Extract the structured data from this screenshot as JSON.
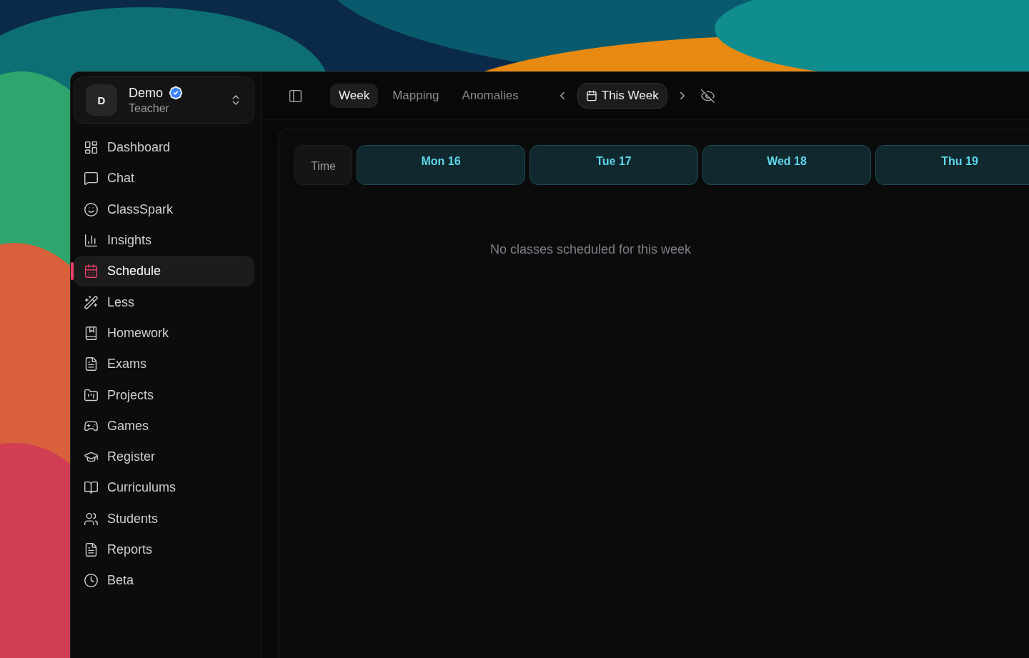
{
  "account": {
    "initial": "D",
    "name": "Demo",
    "verified": true,
    "role": "Teacher"
  },
  "sidebar": {
    "items": [
      {
        "label": "Dashboard",
        "selected": false
      },
      {
        "label": "Chat",
        "selected": false
      },
      {
        "label": "ClassSpark",
        "selected": false
      },
      {
        "label": "Insights",
        "selected": false
      },
      {
        "label": "Schedule",
        "selected": true
      },
      {
        "label": "Less",
        "selected": false
      },
      {
        "label": "Homework",
        "selected": false
      },
      {
        "label": "Exams",
        "selected": false
      },
      {
        "label": "Projects",
        "selected": false
      },
      {
        "label": "Games",
        "selected": false
      },
      {
        "label": "Register",
        "selected": false
      },
      {
        "label": "Curriculums",
        "selected": false
      },
      {
        "label": "Students",
        "selected": false
      },
      {
        "label": "Reports",
        "selected": false
      },
      {
        "label": "Beta",
        "selected": false
      }
    ]
  },
  "toolbar": {
    "views": [
      {
        "label": "Week",
        "selected": true
      },
      {
        "label": "Mapping",
        "selected": false
      },
      {
        "label": "Anomalies",
        "selected": false
      }
    ],
    "range": "This Week"
  },
  "schedule": {
    "time_label": "Time",
    "days": [
      "Mon 16",
      "Tue 17",
      "Wed 18",
      "Thu 19"
    ],
    "empty_message": "No classes scheduled for this week"
  }
}
